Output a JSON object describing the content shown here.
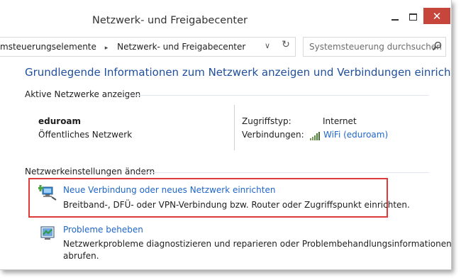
{
  "window": {
    "title": "Netzwerk- und Freigabecenter",
    "close_glyph": "✕",
    "minimize_glyph": "",
    "maximize_glyph": ""
  },
  "address": {
    "crumbs": [
      "msteuerungselemente",
      "Netzwerk- und Freigabecenter"
    ],
    "separator": "▸",
    "dropdown_glyph": "∨",
    "refresh_glyph": "↻"
  },
  "search": {
    "placeholder": "Systemsteuerung durchsuchen"
  },
  "main": {
    "heading": "Grundlegende Informationen zum Netzwerk anzeigen und Verbindungen einrichten",
    "active_networks_label": "Aktive Netzwerke anzeigen",
    "network": {
      "name": "eduroam",
      "type": "Öffentliches Netzwerk",
      "access_type_label": "Zugriffstyp:",
      "access_type_value": "Internet",
      "connections_label": "Verbindungen:",
      "connections_value": "WiFi (eduroam)"
    },
    "change_settings_label": "Netzwerkeinstellungen ändern",
    "tasks": [
      {
        "link": "Neue Verbindung oder neues Netzwerk einrichten",
        "description": "Breitband-, DFÜ- oder VPN-Verbindung bzw. Router oder Zugriffspunkt einrichten."
      },
      {
        "link": "Probleme beheben",
        "description_line1": "Netzwerkprobleme diagnostizieren und reparieren oder Problembehandlungsinformationen",
        "description_line2": "abrufen."
      }
    ]
  },
  "colors": {
    "heading_blue": "#1e4e9c",
    "link_blue": "#1e66c8",
    "highlight_red": "#de3a3a",
    "close_red": "#c7463c"
  },
  "icons": {
    "search": "search-icon",
    "wifi": "wifi-signal-icon",
    "new_connection": "network-setup-icon",
    "troubleshoot": "troubleshoot-icon",
    "refresh": "refresh-icon",
    "dropdown": "chevron-down-icon"
  }
}
